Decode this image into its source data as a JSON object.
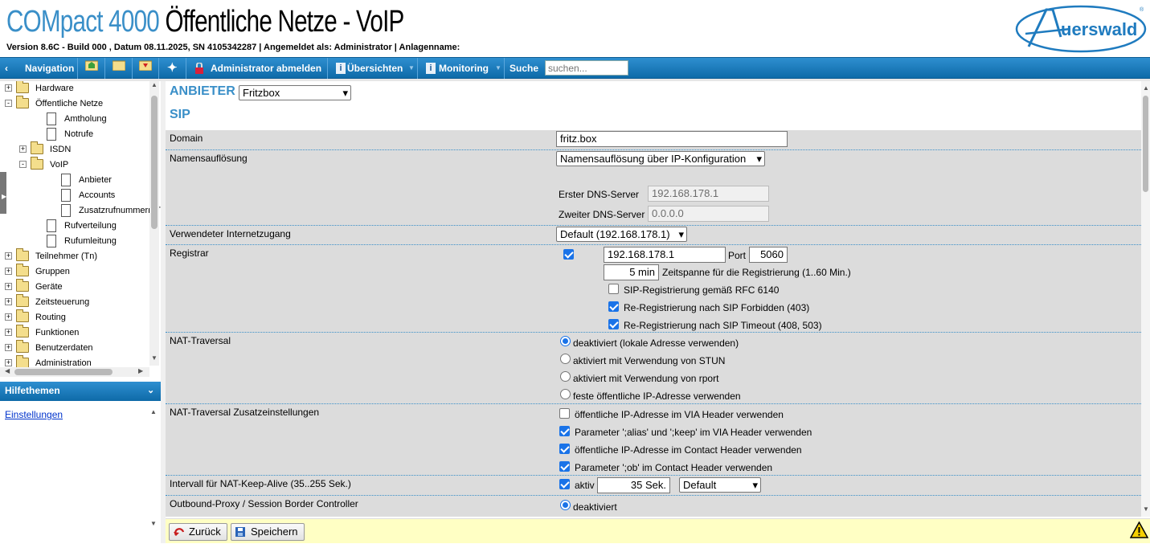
{
  "header": {
    "product": "COMpact 4000",
    "page_title": "Öffentliche Netze - VoIP",
    "info_line": "Version 8.6C - Build 000 ,  Datum 08.11.2025,  SN 4105342287 |  Angemeldet als: Administrator |  Anlagenname:",
    "logo_text": "Auerswald"
  },
  "toolbar": {
    "navigation": "Navigation",
    "logout": "Administrator abmelden",
    "overviews": "Übersichten",
    "monitoring": "Monitoring",
    "search_label": "Suche",
    "search_placeholder": "suchen..."
  },
  "tree": [
    {
      "label": "Hardware",
      "type": "folder",
      "level": 0,
      "expander": "+"
    },
    {
      "label": "Öffentliche Netze",
      "type": "folder-open",
      "level": 0,
      "expander": "-"
    },
    {
      "label": "Amtholung",
      "type": "doc",
      "level": 1,
      "expander": ""
    },
    {
      "label": "Notrufe",
      "type": "doc",
      "level": 1,
      "expander": ""
    },
    {
      "label": "ISDN",
      "type": "folder",
      "level": 1,
      "expander": "+"
    },
    {
      "label": "VoIP",
      "type": "folder-open",
      "level": 1,
      "expander": "-"
    },
    {
      "label": "Anbieter",
      "type": "doc",
      "level": 2,
      "expander": ""
    },
    {
      "label": "Accounts",
      "type": "doc",
      "level": 2,
      "expander": ""
    },
    {
      "label": "Zusatzrufnummern Tl",
      "type": "doc",
      "level": 2,
      "expander": ""
    },
    {
      "label": "Rufverteilung",
      "type": "doc",
      "level": 1,
      "expander": ""
    },
    {
      "label": "Rufumleitung",
      "type": "doc",
      "level": 1,
      "expander": ""
    },
    {
      "label": "Teilnehmer (Tn)",
      "type": "folder",
      "level": 0,
      "expander": "+"
    },
    {
      "label": "Gruppen",
      "type": "folder",
      "level": 0,
      "expander": "+"
    },
    {
      "label": "Geräte",
      "type": "folder",
      "level": 0,
      "expander": "+"
    },
    {
      "label": "Zeitsteuerung",
      "type": "folder",
      "level": 0,
      "expander": "+"
    },
    {
      "label": "Routing",
      "type": "folder",
      "level": 0,
      "expander": "+"
    },
    {
      "label": "Funktionen",
      "type": "folder",
      "level": 0,
      "expander": "+"
    },
    {
      "label": "Benutzerdaten",
      "type": "folder",
      "level": 0,
      "expander": "+"
    },
    {
      "label": "Administration",
      "type": "folder",
      "level": 0,
      "expander": "+"
    }
  ],
  "help": {
    "title": "Hilfethemen",
    "link": "Einstellungen"
  },
  "main": {
    "provider_heading": "ANBIETER",
    "provider_selected": "Fritzbox",
    "sip_heading": "SIP",
    "domain": {
      "label": "Domain",
      "value": "fritz.box"
    },
    "name_resolution": {
      "label": "Namensauflösung",
      "selected": "Namensauflösung über IP-Konfiguration",
      "dns1_label": "Erster DNS-Server",
      "dns1_value": "192.168.178.1",
      "dns2_label": "Zweiter DNS-Server",
      "dns2_value": "0.0.0.0"
    },
    "internet_access": {
      "label": "Verwendeter Internetzugang",
      "selected": "Default (192.168.178.1)"
    },
    "registrar": {
      "label": "Registrar",
      "enabled": true,
      "address": "192.168.178.1",
      "port_label": "Port",
      "port": "5060",
      "interval": "5 min",
      "interval_label": "Zeitspanne für die Registrierung (1..60 Min.)",
      "options": [
        {
          "label": "SIP-Registrierung gemäß RFC 6140",
          "checked": false
        },
        {
          "label": "Re-Registrierung nach SIP Forbidden (403)",
          "checked": true
        },
        {
          "label": "Re-Registrierung nach SIP Timeout (408, 503)",
          "checked": true
        }
      ]
    },
    "nat_traversal": {
      "label": "NAT-Traversal",
      "options": [
        {
          "label": "deaktiviert (lokale Adresse verwenden)",
          "selected": true
        },
        {
          "label": "aktiviert mit Verwendung von STUN",
          "selected": false
        },
        {
          "label": "aktiviert mit Verwendung von rport",
          "selected": false
        },
        {
          "label": "feste öffentliche IP-Adresse verwenden",
          "selected": false
        }
      ]
    },
    "nat_extra": {
      "label": "NAT-Traversal Zusatzeinstellungen",
      "options": [
        {
          "label": "öffentliche IP-Adresse im VIA Header verwenden",
          "checked": false
        },
        {
          "label": "Parameter ';alias' und ';keep' im VIA Header verwenden",
          "checked": true
        },
        {
          "label": "öffentliche IP-Adresse im Contact Header verwenden",
          "checked": true
        },
        {
          "label": "Parameter ';ob' im Contact Header verwenden",
          "checked": true
        }
      ]
    },
    "keepalive": {
      "label": "Intervall für NAT-Keep-Alive (35..255 Sek.)",
      "enabled": true,
      "active_label": "aktiv",
      "value": "35 Sek.",
      "mode": "Default"
    },
    "outbound_proxy": {
      "label": "Outbound-Proxy / Session Border Controller",
      "option": "deaktiviert",
      "selected": true
    }
  },
  "footer": {
    "back": "Zurück",
    "save": "Speichern"
  },
  "colors": {
    "accent": "#3a8fc8",
    "toolbar": "#1379bb",
    "row_bg": "#dcdcdc",
    "footer_bg": "#ffffc4"
  }
}
